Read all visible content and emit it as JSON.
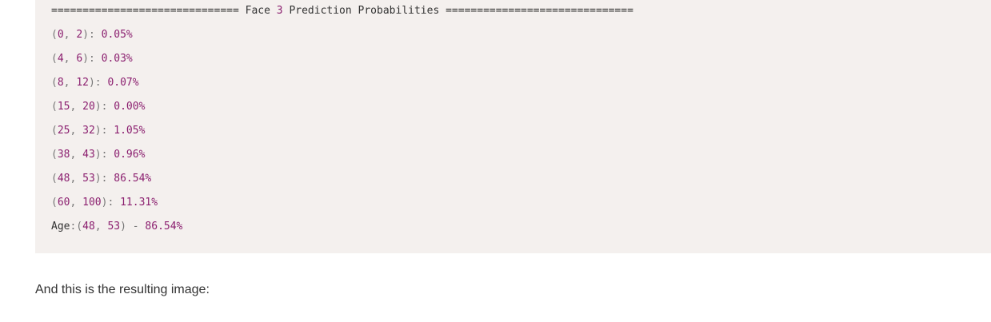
{
  "code": {
    "banner": {
      "left_rule": "==============================",
      "title_prefix": "Face",
      "face_number": "3",
      "title_suffix": "Prediction Probabilities",
      "right_rule": "=============================="
    },
    "rows": [
      {
        "low": "0",
        "high": "2",
        "pct": "0.05%"
      },
      {
        "low": "4",
        "high": "6",
        "pct": "0.03%"
      },
      {
        "low": "8",
        "high": "12",
        "pct": "0.07%"
      },
      {
        "low": "15",
        "high": "20",
        "pct": "0.00%"
      },
      {
        "low": "25",
        "high": "32",
        "pct": "1.05%"
      },
      {
        "low": "38",
        "high": "43",
        "pct": "0.96%"
      },
      {
        "low": "48",
        "high": "53",
        "pct": "86.54%"
      },
      {
        "low": "60",
        "high": "100",
        "pct": "11.31%"
      }
    ],
    "result": {
      "label": "Age",
      "low": "48",
      "high": "53",
      "pct": "86.54%"
    }
  },
  "prose": {
    "text": "And this is the resulting image:"
  },
  "colors": {
    "block_background": "#f4f0ee",
    "number": "#8b1f6f",
    "punctuation": "#777777",
    "text": "#333333"
  }
}
